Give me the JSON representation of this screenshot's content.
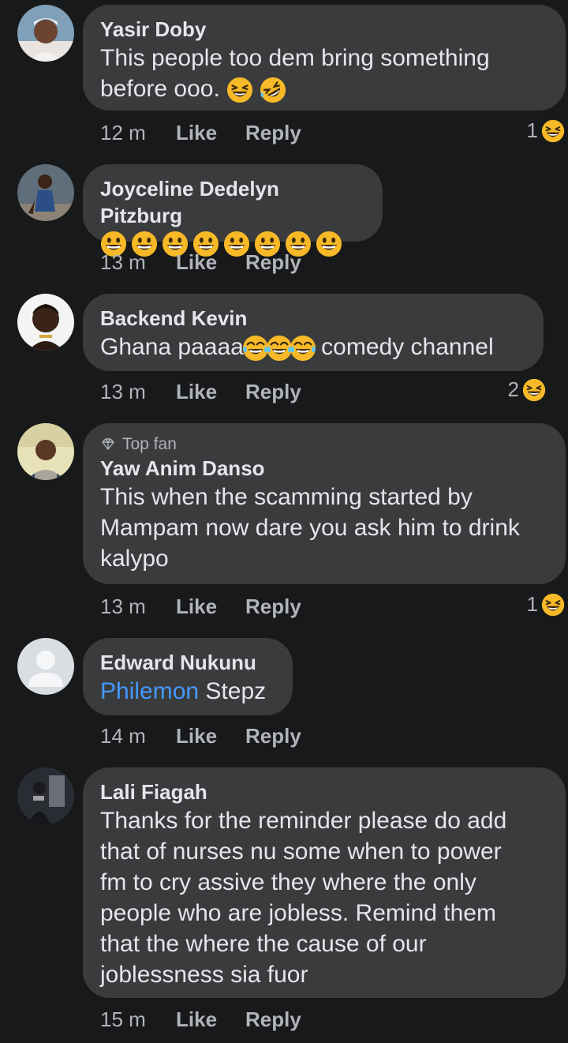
{
  "comments": [
    {
      "name": "Yasir Doby",
      "text": "This people too dem bring something\nbefore ooo.",
      "time": "12 m",
      "like": "Like",
      "reply": "Reply",
      "reaction_count": "1",
      "avatar": "avatar-photo-man-white-cap"
    },
    {
      "name": "Joyceline Dedelyn Pitzburg",
      "text": "",
      "time": "13 m",
      "like": "Like",
      "reply": "Reply",
      "avatar": "avatar-photo-woman"
    },
    {
      "name": "Backend Kevin",
      "text": "Ghana paaaa",
      "text_after": " comedy channel",
      "time": "13 m",
      "like": "Like",
      "reply": "Reply",
      "reaction_count": "2",
      "avatar": "avatar-photo-man"
    },
    {
      "badge": "Top fan",
      "name": "Yaw Anim Danso",
      "text": "This when the scamming started by\nMampam now dare you ask him to drink\nkalypo",
      "time": "13 m",
      "like": "Like",
      "reply": "Reply",
      "reaction_count": "1",
      "avatar": "avatar-photo-man-outdoor"
    },
    {
      "name": "Edward Nukunu",
      "mention": "Philemon",
      "text": " Stepz",
      "time": "14 m",
      "like": "Like",
      "reply": "Reply",
      "avatar": "avatar-default"
    },
    {
      "name": "Lali Fiagah",
      "text": "Thanks for the reminder please do add\nthat of nurses nu some when to power\nfm to cry assive they where the only\npeople who are jobless. Remind them\nthat the where the cause of our\njoblessness sia fuor",
      "time": "15 m",
      "like": "Like",
      "reply": "Reply",
      "avatar": "avatar-photo-dark"
    }
  ],
  "colors": {
    "background": "#18191a",
    "bubble": "#3a3b3c",
    "text": "#e4e6eb",
    "meta": "#b0b3b8",
    "mention": "#4599ff",
    "emoji": "#f7b928"
  }
}
